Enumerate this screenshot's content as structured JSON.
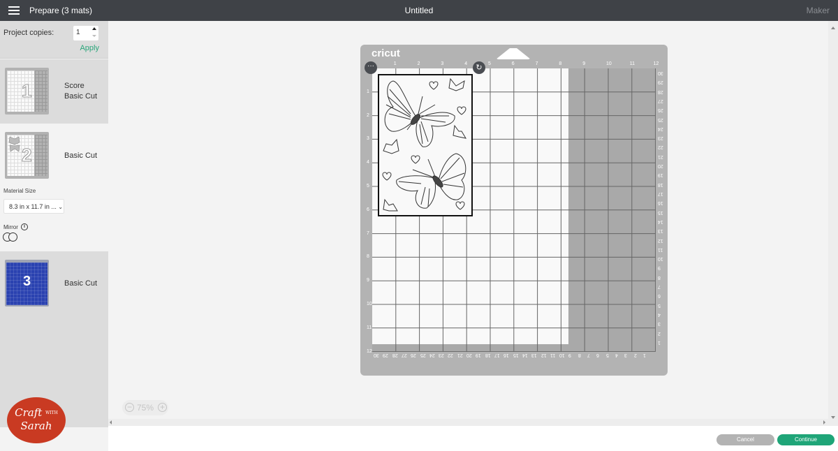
{
  "topbar": {
    "app_title": "Prepare (3 mats)",
    "doc_title": "Untitled",
    "machine": "Maker"
  },
  "sidebar": {
    "copies_label": "Project copies:",
    "copies_value": "1",
    "apply_label": "Apply",
    "mats": [
      {
        "number": "1",
        "labels": [
          "Score",
          "Basic Cut"
        ],
        "color": "#f9f9f9",
        "active": true
      },
      {
        "number": "2",
        "labels": [
          "Basic Cut"
        ],
        "color": "#f9f9f9",
        "active": false
      },
      {
        "number": "3",
        "labels": [
          "Basic Cut"
        ],
        "color": "#2a42b0",
        "active": true
      }
    ],
    "material_size_label": "Material Size",
    "material_size_value": "8.3 in x 11.7 in ...",
    "mirror_label": "Mirror",
    "mirror_on": false,
    "logo": {
      "line1": "Craft",
      "with": "WITH",
      "line2": "Sarah"
    }
  },
  "canvas": {
    "zoom_level": "75%",
    "mat_brand": "cricut",
    "top_ruler": [
      "1",
      "2",
      "3",
      "4",
      "5",
      "6",
      "7",
      "8",
      "9",
      "10",
      "11",
      "12"
    ],
    "left_ruler": [
      "1",
      "2",
      "3",
      "4",
      "5",
      "6",
      "7",
      "8",
      "9",
      "10",
      "11",
      "12"
    ],
    "bottom_ruler_cm": [
      "30",
      "29",
      "28",
      "27",
      "26",
      "25",
      "24",
      "23",
      "22",
      "21",
      "20",
      "19",
      "18",
      "17",
      "16",
      "15",
      "14",
      "13",
      "12",
      "11",
      "10",
      "9",
      "8",
      "7",
      "6",
      "5",
      "4",
      "3",
      "2",
      "1"
    ],
    "right_ruler_cm": [
      "30",
      "29",
      "28",
      "27",
      "26",
      "25",
      "24",
      "23",
      "22",
      "21",
      "20",
      "19",
      "18",
      "17",
      "16",
      "15",
      "14",
      "13",
      "12",
      "11",
      "10",
      "9",
      "8",
      "7",
      "6",
      "5",
      "4",
      "3",
      "2",
      "1"
    ],
    "material_in": {
      "width": 8.3,
      "height": 11.7
    },
    "design": {
      "width_in": 4,
      "height_in": 6,
      "content": "butterflies and hearts"
    }
  },
  "footer": {
    "cancel_label": "Cancel",
    "continue_label": "Continue"
  },
  "colors": {
    "accent": "#1fa578",
    "topbar": "#3f4247",
    "mat": "#b3b3b3",
    "logo": "#c93a22"
  }
}
